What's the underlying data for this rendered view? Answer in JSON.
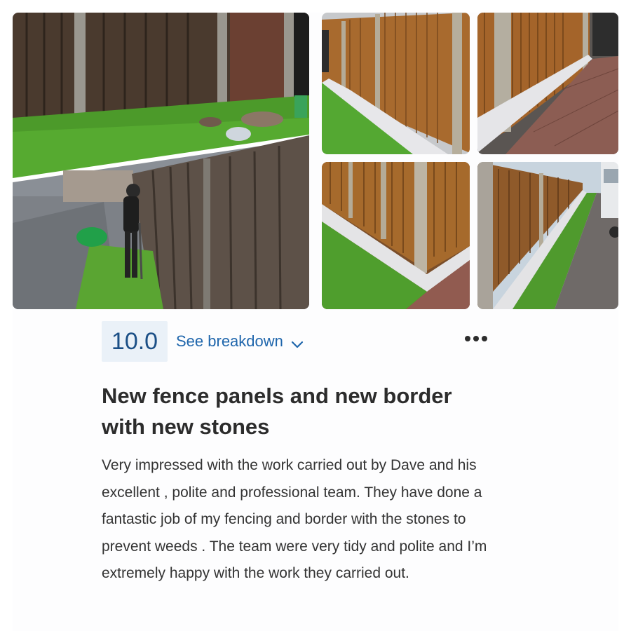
{
  "photos": [
    {
      "name": "fence-photo-old-fence-and-worker"
    },
    {
      "name": "fence-photo-new-panels-lawn"
    },
    {
      "name": "fence-photo-new-panels-driveway"
    },
    {
      "name": "fence-photo-new-panels-corner"
    },
    {
      "name": "fence-photo-new-panels-long-run"
    }
  ],
  "review": {
    "score": "10.0",
    "breakdown_label": "See breakdown",
    "title": "New fence panels and new border with new stones",
    "body": "Very impressed with the work carried out by Dave and his excellent , polite and professional team. They have done a fantastic job of my fencing and border with the stones to prevent weeds . The team were very tidy and polite and I’m extremely happy with the work they carried out."
  },
  "icons": {
    "chevron": "chevron-down-icon",
    "more": "more-options-icon"
  },
  "colors": {
    "score_bg": "#eaf1f8",
    "score_text": "#1b4f86",
    "link": "#1f66ac",
    "title": "#2c2c2c",
    "body": "#333333"
  }
}
